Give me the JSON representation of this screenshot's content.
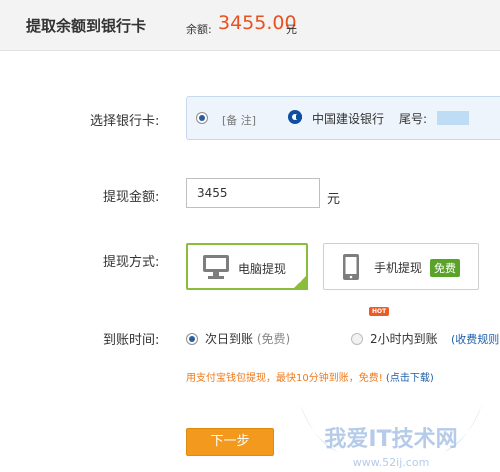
{
  "header": {
    "title": "提取余额到银行卡",
    "balance_label": "余额:",
    "balance_amount": "3455.00",
    "balance_unit": "元"
  },
  "bank_card": {
    "label": "选择银行卡:",
    "note": "[备 注]",
    "bank_name": "中国建设银行",
    "tail_label": "尾号:"
  },
  "amount": {
    "label": "提现金额:",
    "value": "3455",
    "unit": "元"
  },
  "method": {
    "label": "提现方式:",
    "options": [
      {
        "label": "电脑提现",
        "selected": true
      },
      {
        "label": "手机提现",
        "badge": "免费",
        "selected": false
      }
    ]
  },
  "arrival": {
    "label": "到账时间:",
    "options": [
      {
        "label": "次日到账",
        "sub": "(免费)",
        "selected": true
      },
      {
        "label": "2小时内到账",
        "badge": "HOT",
        "selected": false
      }
    ],
    "fee_link": "(收费规则"
  },
  "promo": {
    "text": "用支付宝钱包提现，最快10分钟到账，免费! ",
    "link": "(点击下载)"
  },
  "next_button": "下一步",
  "watermark": {
    "title": "我爱IT技术网",
    "url": "www.52ij.com"
  },
  "colors": {
    "accent_orange": "#f39a1e",
    "balance_red": "#e8511f",
    "selected_green": "#8bbd3c",
    "link_blue": "#1d5fa8"
  }
}
